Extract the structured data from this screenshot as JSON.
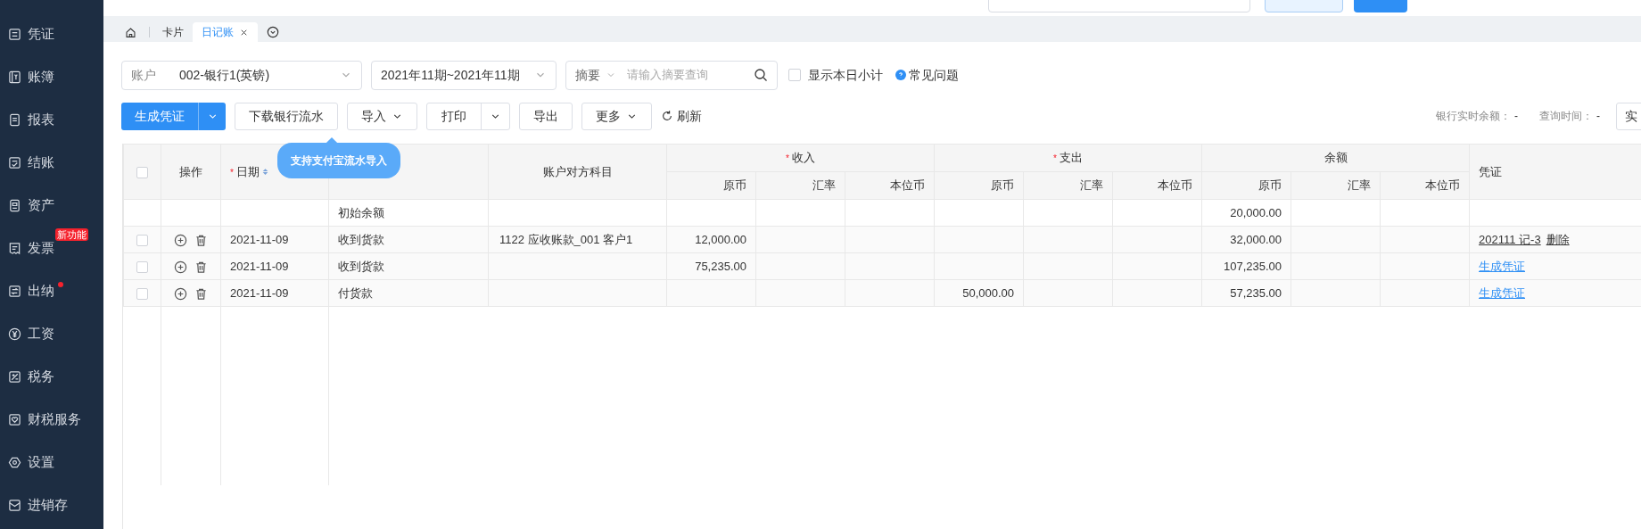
{
  "sidebar": {
    "items": [
      {
        "label": "凭证"
      },
      {
        "label": "账簿"
      },
      {
        "label": "报表"
      },
      {
        "label": "结账"
      },
      {
        "label": "资产"
      },
      {
        "label": "发票",
        "badge": "新功能"
      },
      {
        "label": "出纳",
        "dot": true
      },
      {
        "label": "工资"
      },
      {
        "label": "税务"
      },
      {
        "label": "财税服务"
      },
      {
        "label": "设置"
      },
      {
        "label": "进销存"
      }
    ]
  },
  "tabs": [
    {
      "kind": "home",
      "selected": false
    },
    {
      "kind": "text",
      "label": "卡片",
      "selected": false
    },
    {
      "kind": "text",
      "label": "日记账",
      "selected": true,
      "closable": true
    },
    {
      "kind": "more",
      "selected": false
    }
  ],
  "filters": {
    "account": {
      "label": "账户",
      "value": "002-银行1(英镑)"
    },
    "period": "2021年11期~2021年11期",
    "summary": {
      "label": "摘要",
      "placeholder": "请输入摘要查询"
    },
    "daily_subtotal": {
      "label": "显示本日小计",
      "checked": false
    },
    "help": "常见问题"
  },
  "toolbar": {
    "buttons": [
      {
        "kind": "primary-split",
        "label": "生成凭证"
      },
      {
        "kind": "plain",
        "label": "下载银行流水"
      },
      {
        "kind": "dropdown",
        "label": "导入"
      },
      {
        "kind": "split",
        "label": "打印"
      },
      {
        "kind": "plain",
        "label": "导出"
      },
      {
        "kind": "dropdown",
        "label": "更多"
      },
      {
        "kind": "refresh",
        "label": "刷新"
      }
    ],
    "bank_balance": {
      "label": "银行实时余额：",
      "value": "-"
    },
    "query_time": {
      "label": "查询时间：",
      "value": "-"
    },
    "cut_button": "实"
  },
  "tooltip": "支持支付宝流水导入",
  "table": {
    "groups": [
      {
        "label": "收入",
        "required_mark": "*",
        "columns": [
          "原币",
          "汇率",
          "本位币"
        ]
      },
      {
        "label": "支出",
        "required_mark": "*",
        "columns": [
          "原币",
          "汇率",
          "本位币"
        ]
      },
      {
        "label": "余额",
        "columns": [
          "原币",
          "汇率",
          "本位币"
        ]
      }
    ],
    "columns": {
      "select_all": {
        "checked": false
      },
      "actions": "操作",
      "date": {
        "label": "日期",
        "required_mark": "*",
        "sortable": true
      },
      "account": "账户对方科目",
      "voucher": "凭证"
    },
    "rows": [
      {
        "kind": "opening",
        "summary": "初始余额",
        "amounts": {
          "balance_original": "20,000.00"
        },
        "voucher": {
          "kind": "none"
        }
      },
      {
        "kind": "entry",
        "checked": false,
        "date": "2021-11-09",
        "summary": "收到货款",
        "account": "1122 应收账款_001 客户1",
        "amounts": {
          "income_original": "12,000.00",
          "balance_original": "32,000.00"
        },
        "voucher": {
          "kind": "posted",
          "number": "202111 记-3",
          "action": "删除"
        }
      },
      {
        "kind": "entry",
        "checked": false,
        "date": "2021-11-09",
        "summary": "收到货款",
        "amounts": {
          "income_original": "75,235.00",
          "balance_original": "107,235.00"
        },
        "voucher": {
          "kind": "pending",
          "action": "生成凭证"
        }
      },
      {
        "kind": "entry",
        "checked": false,
        "date": "2021-11-09",
        "summary": "付货款",
        "amounts": {
          "expense_original": "50,000.00",
          "balance_original": "57,235.00"
        },
        "voucher": {
          "kind": "pending",
          "action": "生成凭证"
        }
      }
    ]
  }
}
